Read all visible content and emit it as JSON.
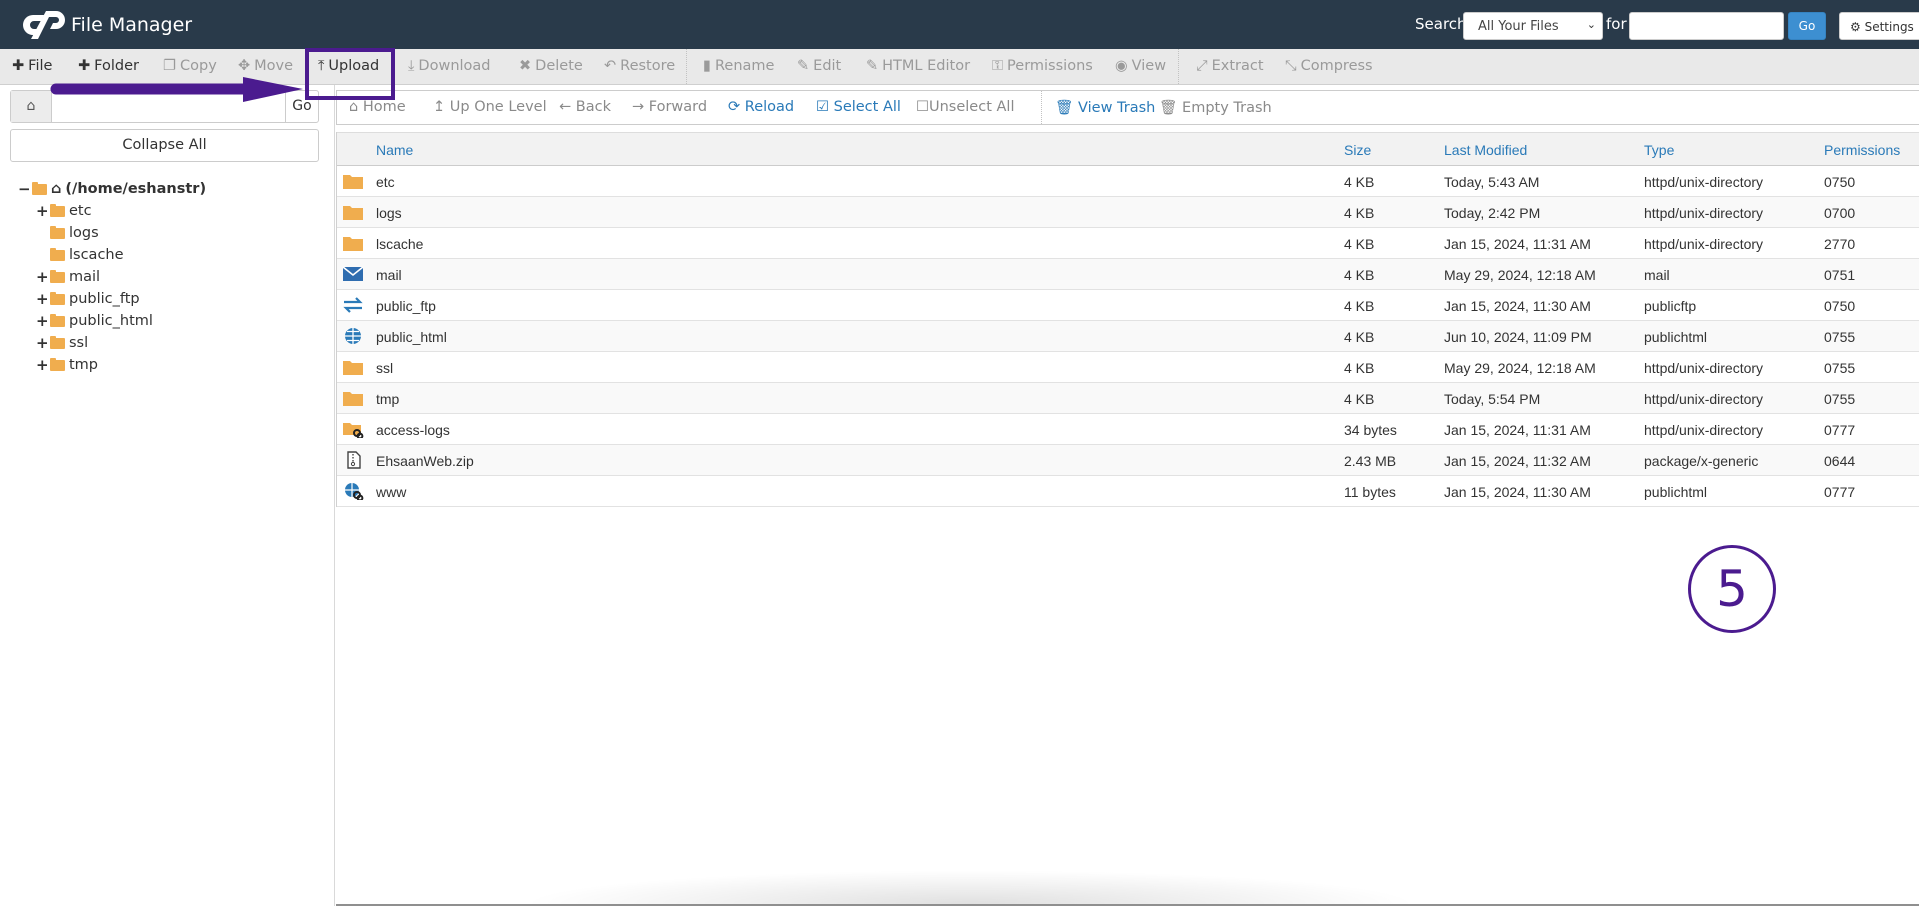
{
  "header": {
    "app_title": "File Manager",
    "search_label": "Search",
    "search_scope": "All Your Files",
    "for_label": "for",
    "search_value": "",
    "go_label": "Go",
    "settings_label": "Settings",
    "accent": "#3d8fd1",
    "bg": "#293a4a"
  },
  "toolbar": {
    "items": [
      {
        "label": "File",
        "icon": "plus-icon",
        "enabled": true
      },
      {
        "label": "Folder",
        "icon": "plus-icon",
        "enabled": true
      },
      {
        "label": "Copy",
        "icon": "copy-icon",
        "enabled": false
      },
      {
        "label": "Move",
        "icon": "move-icon",
        "enabled": false
      },
      {
        "label": "Upload",
        "icon": "upload-icon",
        "enabled": true
      },
      {
        "label": "Download",
        "icon": "download-icon",
        "enabled": false
      },
      {
        "label": "Delete",
        "icon": "delete-icon",
        "enabled": false
      },
      {
        "label": "Restore",
        "icon": "restore-icon",
        "enabled": false
      },
      {
        "label": "Rename",
        "icon": "file-icon",
        "enabled": false
      },
      {
        "label": "Edit",
        "icon": "pencil-icon",
        "enabled": false
      },
      {
        "label": "HTML Editor",
        "icon": "edit-square-icon",
        "enabled": false
      },
      {
        "label": "Permissions",
        "icon": "key-icon",
        "enabled": false
      },
      {
        "label": "View",
        "icon": "eye-icon",
        "enabled": false
      },
      {
        "label": "Extract",
        "icon": "expand-icon",
        "enabled": false
      },
      {
        "label": "Compress",
        "icon": "compress-icon",
        "enabled": false
      }
    ]
  },
  "sidebar": {
    "path_value": "",
    "go_label": "Go",
    "collapse_label": "Collapse All",
    "tree": {
      "root": "(/home/eshanstr)",
      "children": [
        {
          "name": "etc",
          "expandable": true
        },
        {
          "name": "logs",
          "expandable": false
        },
        {
          "name": "lscache",
          "expandable": false
        },
        {
          "name": "mail",
          "expandable": true
        },
        {
          "name": "public_ftp",
          "expandable": true
        },
        {
          "name": "public_html",
          "expandable": true
        },
        {
          "name": "ssl",
          "expandable": true
        },
        {
          "name": "tmp",
          "expandable": true
        }
      ]
    }
  },
  "nav": {
    "home": "Home",
    "up": "Up One Level",
    "back": "Back",
    "forward": "Forward",
    "reload": "Reload",
    "select_all": "Select All",
    "unselect_all": "Unselect All",
    "view_trash": "View Trash",
    "empty_trash": "Empty Trash"
  },
  "table": {
    "columns": [
      "Name",
      "Size",
      "Last Modified",
      "Type",
      "Permissions"
    ],
    "rows": [
      {
        "icon": "folder-icon",
        "name": "etc",
        "size": "4 KB",
        "modified": "Today, 5:43 AM",
        "type": "httpd/unix-directory",
        "perms": "0750"
      },
      {
        "icon": "folder-icon",
        "name": "logs",
        "size": "4 KB",
        "modified": "Today, 2:42 PM",
        "type": "httpd/unix-directory",
        "perms": "0700"
      },
      {
        "icon": "folder-icon",
        "name": "lscache",
        "size": "4 KB",
        "modified": "Jan 15, 2024, 11:31 AM",
        "type": "httpd/unix-directory",
        "perms": "2770"
      },
      {
        "icon": "mail-icon",
        "name": "mail",
        "size": "4 KB",
        "modified": "May 29, 2024, 12:18 AM",
        "type": "mail",
        "perms": "0751"
      },
      {
        "icon": "transfer-icon",
        "name": "public_ftp",
        "size": "4 KB",
        "modified": "Jan 15, 2024, 11:30 AM",
        "type": "publicftp",
        "perms": "0750"
      },
      {
        "icon": "globe-icon",
        "name": "public_html",
        "size": "4 KB",
        "modified": "Jun 10, 2024, 11:09 PM",
        "type": "publichtml",
        "perms": "0755"
      },
      {
        "icon": "folder-icon",
        "name": "ssl",
        "size": "4 KB",
        "modified": "May 29, 2024, 12:18 AM",
        "type": "httpd/unix-directory",
        "perms": "0755"
      },
      {
        "icon": "folder-icon",
        "name": "tmp",
        "size": "4 KB",
        "modified": "Today, 5:54 PM",
        "type": "httpd/unix-directory",
        "perms": "0755"
      },
      {
        "icon": "folder-link-icon",
        "name": "access-logs",
        "size": "34 bytes",
        "modified": "Jan 15, 2024, 11:31 AM",
        "type": "httpd/unix-directory",
        "perms": "0777"
      },
      {
        "icon": "zip-file-icon",
        "name": "EhsaanWeb.zip",
        "size": "2.43 MB",
        "modified": "Jan 15, 2024, 11:32 AM",
        "type": "package/x-generic",
        "perms": "0644"
      },
      {
        "icon": "globe-link-icon",
        "name": "www",
        "size": "11 bytes",
        "modified": "Jan 15, 2024, 11:30 AM",
        "type": "publichtml",
        "perms": "0777"
      }
    ]
  },
  "annotation": {
    "step_number": "5",
    "color": "#4b1b8f",
    "highlighted": "Upload"
  }
}
